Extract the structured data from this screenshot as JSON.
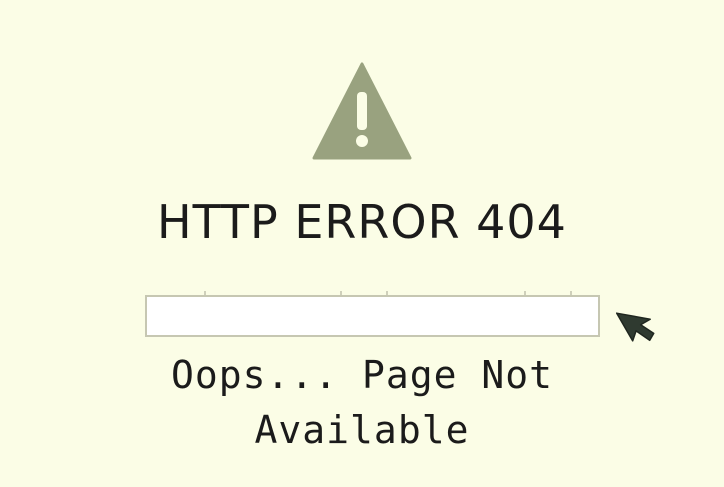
{
  "error": {
    "title": "HTTP ERROR 404",
    "message_line1": "Oops... Page Not",
    "message_line2": "Available",
    "icon": "warning-icon",
    "icon_color": "#99a27f"
  },
  "address_bar": {
    "value": ""
  },
  "cursor": {
    "icon": "cursor-arrow-icon",
    "color": "#2f3a30"
  },
  "colors": {
    "background": "#fbfde6",
    "text": "#1b1b1b"
  }
}
